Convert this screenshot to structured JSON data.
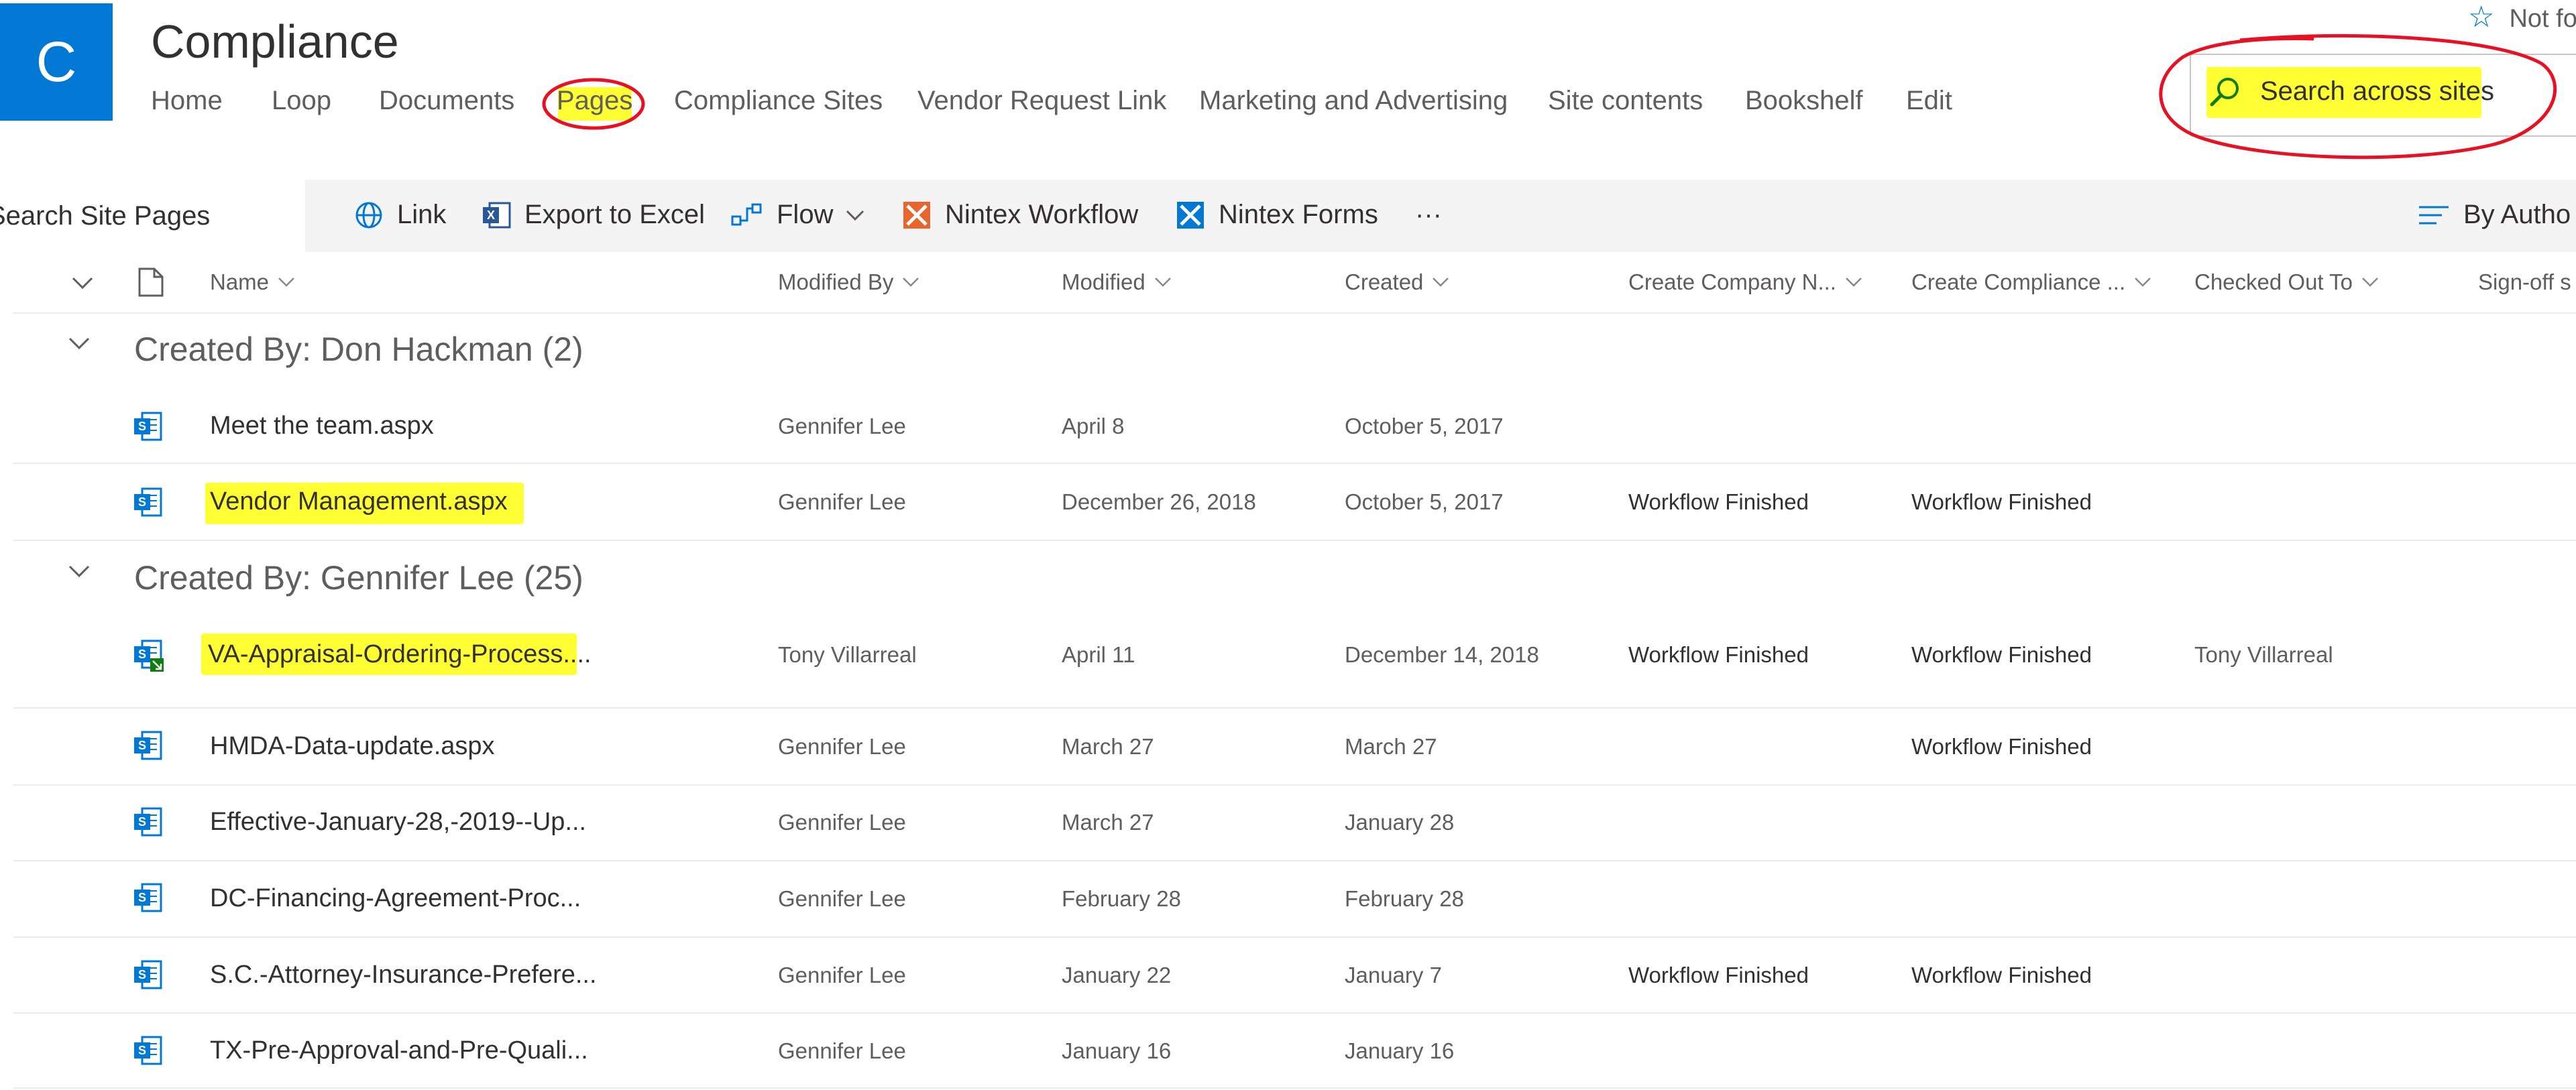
{
  "site": {
    "logo_letter": "C",
    "title": "Compliance",
    "not_following": "Not fo",
    "nav": [
      "Home",
      "Loop",
      "Documents",
      "Pages",
      "Compliance Sites",
      "Vendor Request Link",
      "Marketing and Advertising",
      "Site contents",
      "Bookshelf",
      "Edit"
    ],
    "search_placeholder": "Search across sites"
  },
  "commandbar": {
    "search_placeholder": "Search Site Pages",
    "items": [
      "Link",
      "Export to Excel",
      "Flow",
      "Nintex Workflow",
      "Nintex Forms",
      "···"
    ],
    "view_label": "By Autho"
  },
  "list": {
    "columns": [
      "Name",
      "Modified By",
      "Modified",
      "Created",
      "Create Company N...",
      "Create Compliance ...",
      "Checked Out To",
      "Sign-off s"
    ],
    "groups": [
      {
        "label": "Created By: Don Hackman (2)",
        "rows": [
          {
            "name": "Meet the team.aspx",
            "modified_by": "Gennifer Lee",
            "modified": "April 8",
            "created": "October 5, 2017",
            "company": "",
            "compliance": "",
            "checked_out": ""
          },
          {
            "name": "Vendor Management.aspx",
            "modified_by": "Gennifer Lee",
            "modified": "December 26, 2018",
            "created": "October 5, 2017",
            "company": "Workflow Finished",
            "compliance": "Workflow Finished",
            "checked_out": ""
          }
        ]
      },
      {
        "label": "Created By: Gennifer Lee (25)",
        "rows": [
          {
            "name": "VA-Appraisal-Ordering-Process....",
            "modified_by": "Tony Villarreal",
            "modified": "April 11",
            "created": "December 14, 2018",
            "company": "Workflow Finished",
            "compliance": "Workflow Finished",
            "checked_out": "Tony Villarreal"
          },
          {
            "name": "HMDA-Data-update.aspx",
            "modified_by": "Gennifer Lee",
            "modified": "March 27",
            "created": "March 27",
            "company": "",
            "compliance": "Workflow Finished",
            "checked_out": ""
          },
          {
            "name": "Effective-January-28,-2019--Up...",
            "modified_by": "Gennifer Lee",
            "modified": "March 27",
            "created": "January 28",
            "company": "",
            "compliance": "",
            "checked_out": ""
          },
          {
            "name": "DC-Financing-Agreement-Proc...",
            "modified_by": "Gennifer Lee",
            "modified": "February 28",
            "created": "February 28",
            "company": "",
            "compliance": "",
            "checked_out": ""
          },
          {
            "name": "S.C.-Attorney-Insurance-Prefere...",
            "modified_by": "Gennifer Lee",
            "modified": "January 22",
            "created": "January 7",
            "company": "Workflow Finished",
            "compliance": "Workflow Finished",
            "checked_out": ""
          },
          {
            "name": "TX-Pre-Approval-and-Pre-Quali...",
            "modified_by": "Gennifer Lee",
            "modified": "January 16",
            "created": "January 16",
            "company": "",
            "compliance": "",
            "checked_out": ""
          }
        ]
      }
    ]
  },
  "colors": {
    "brand": "#0078d4",
    "highlight": "#ffff33",
    "annotation": "#e81123",
    "nintex": "#e8662d"
  }
}
